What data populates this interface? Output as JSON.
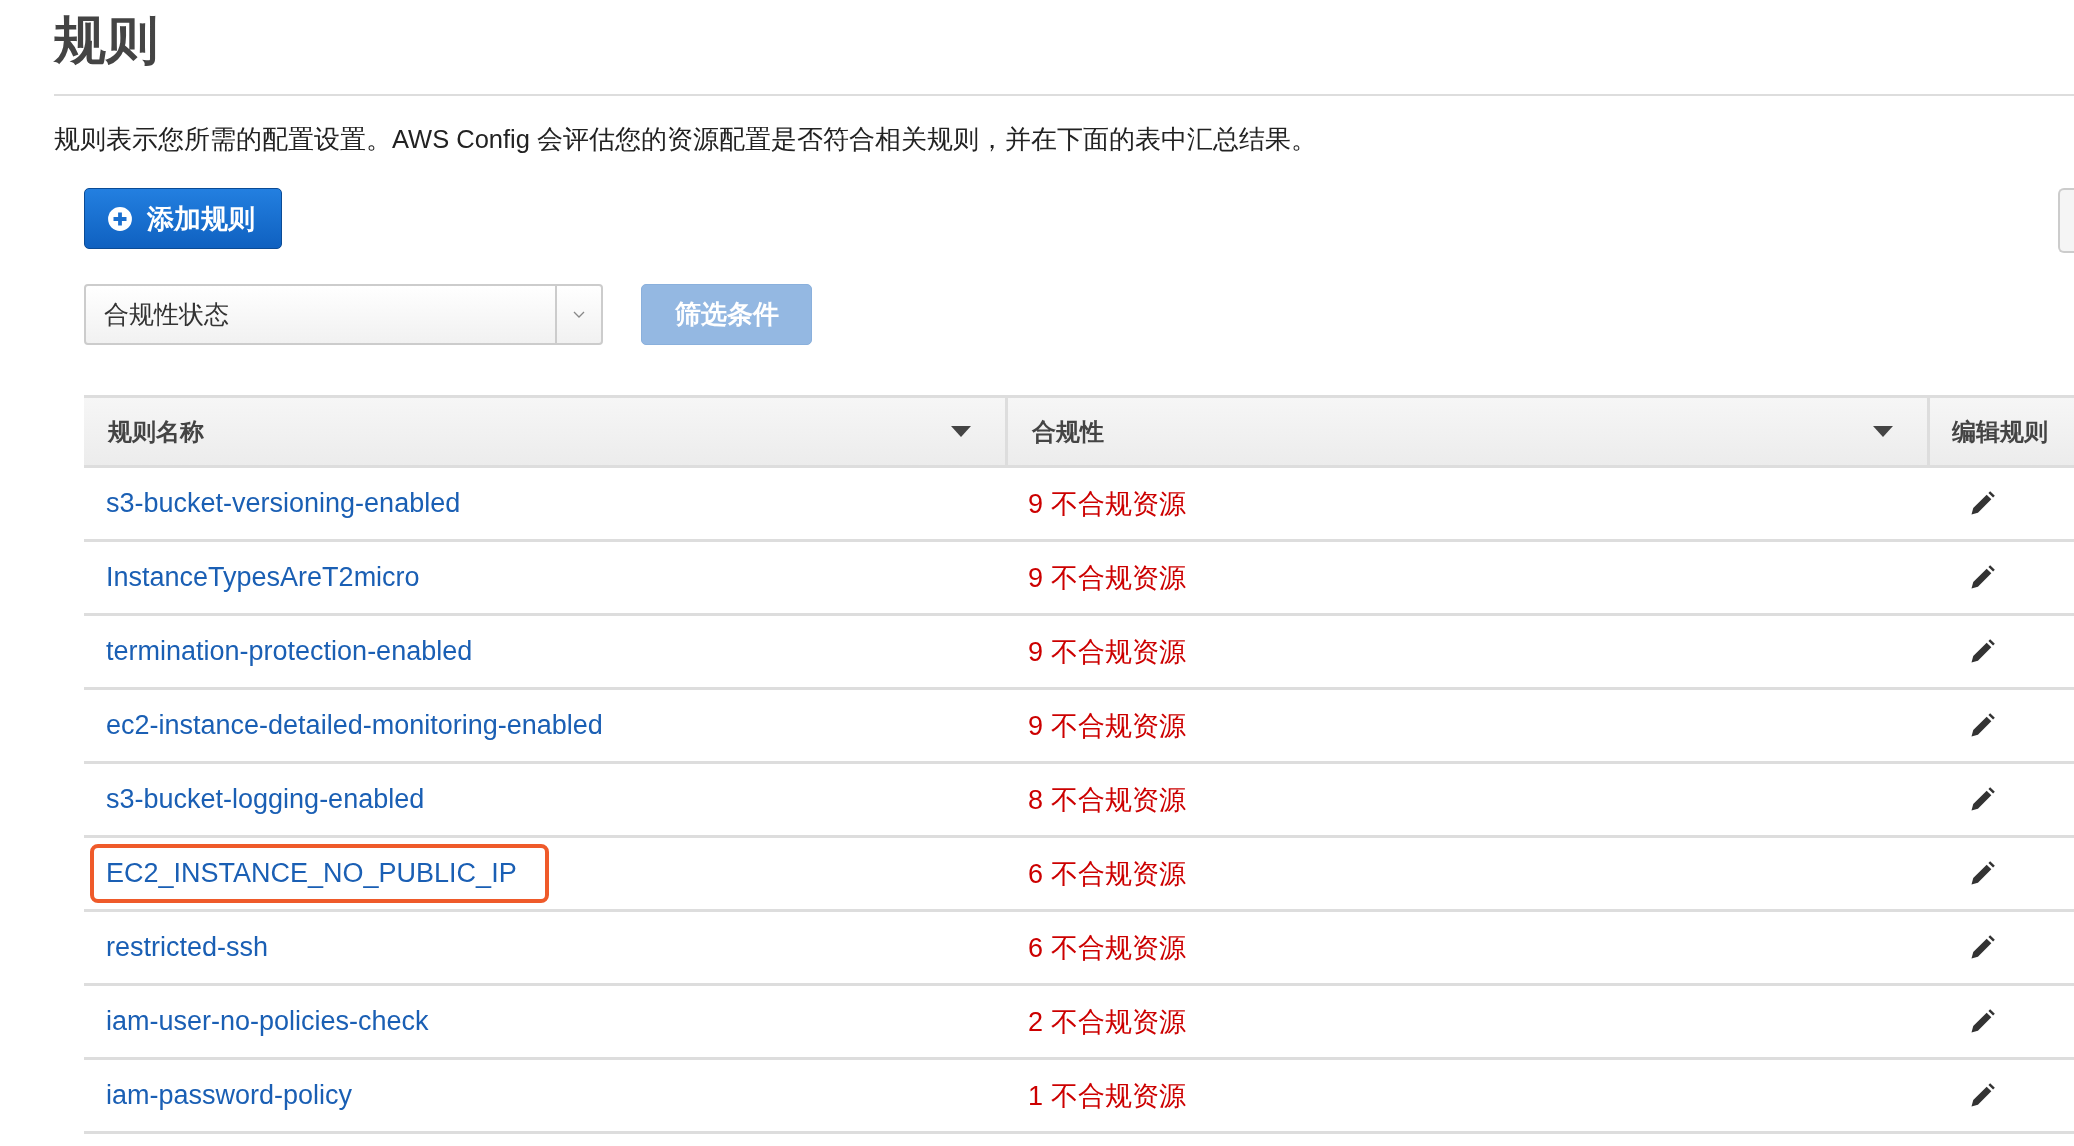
{
  "page": {
    "title": "规则",
    "description": "规则表示您所需的配置设置。AWS Config 会评估您的资源配置是否符合相关规则，并在下面的表中汇总结果。"
  },
  "toolbar": {
    "add_button": "添加规则",
    "filter_select": {
      "value": "合规性状态"
    },
    "filter_button": {
      "label": "筛选条件",
      "disabled": true
    }
  },
  "table": {
    "columns": [
      {
        "label": "规则名称",
        "sortable": true
      },
      {
        "label": "合规性",
        "sortable": true
      },
      {
        "label": "编辑规则",
        "sortable": false
      }
    ],
    "rows": [
      {
        "name": "s3-bucket-versioning-enabled",
        "compliance": "9 不合规资源",
        "highlighted": false
      },
      {
        "name": "InstanceTypesAreT2micro",
        "compliance": "9 不合规资源",
        "highlighted": false
      },
      {
        "name": "termination-protection-enabled",
        "compliance": "9 不合规资源",
        "highlighted": false
      },
      {
        "name": "ec2-instance-detailed-monitoring-enabled",
        "compliance": "9 不合规资源",
        "highlighted": false
      },
      {
        "name": "s3-bucket-logging-enabled",
        "compliance": "8 不合规资源",
        "highlighted": false
      },
      {
        "name": "EC2_INSTANCE_NO_PUBLIC_IP",
        "compliance": "6 不合规资源",
        "highlighted": true
      },
      {
        "name": "restricted-ssh",
        "compliance": "6 不合规资源",
        "highlighted": false
      },
      {
        "name": "iam-user-no-policies-check",
        "compliance": "2 不合规资源",
        "highlighted": false
      },
      {
        "name": "iam-password-policy",
        "compliance": "1 不合规资源",
        "highlighted": false
      }
    ]
  }
}
